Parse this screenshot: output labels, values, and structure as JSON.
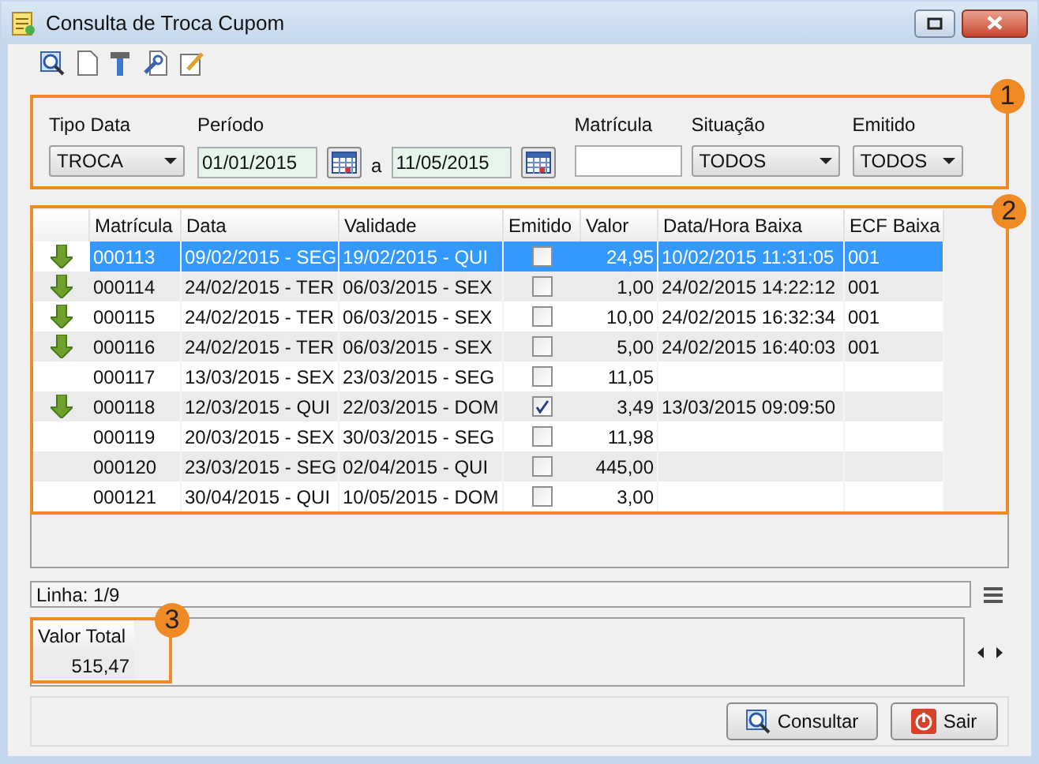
{
  "window": {
    "title": "Consulta de Troca Cupom"
  },
  "filters": {
    "tipo_data": {
      "label": "Tipo Data",
      "value": "TROCA"
    },
    "periodo": {
      "label": "Período",
      "from": "01/01/2015",
      "separator": "a",
      "to": "11/05/2015"
    },
    "matricula": {
      "label": "Matrícula"
    },
    "situacao": {
      "label": "Situação",
      "value": "TODOS"
    },
    "emitido": {
      "label": "Emitido",
      "value": "TODOS"
    }
  },
  "table": {
    "columns": [
      "Matrícula",
      "Data",
      "Validade",
      "Emitido",
      "Valor",
      "Data/Hora Baixa",
      "ECF Baixa"
    ],
    "rows": [
      {
        "arrow": true,
        "matricula": "000113",
        "data": "09/02/2015 - SEG",
        "validade": "19/02/2015 - QUI",
        "emitido": false,
        "valor": "24,95",
        "baixa": "10/02/2015 11:31:05",
        "ecf": "001",
        "selected": true
      },
      {
        "arrow": true,
        "matricula": "000114",
        "data": "24/02/2015 - TER",
        "validade": "06/03/2015 - SEX",
        "emitido": false,
        "valor": "1,00",
        "baixa": "24/02/2015 14:22:12",
        "ecf": "001",
        "selected": false
      },
      {
        "arrow": true,
        "matricula": "000115",
        "data": "24/02/2015 - TER",
        "validade": "06/03/2015 - SEX",
        "emitido": false,
        "valor": "10,00",
        "baixa": "24/02/2015 16:32:34",
        "ecf": "001",
        "selected": false
      },
      {
        "arrow": true,
        "matricula": "000116",
        "data": "24/02/2015 - TER",
        "validade": "06/03/2015 - SEX",
        "emitido": false,
        "valor": "5,00",
        "baixa": "24/02/2015 16:40:03",
        "ecf": "001",
        "selected": false
      },
      {
        "arrow": false,
        "matricula": "000117",
        "data": "13/03/2015 - SEX",
        "validade": "23/03/2015 - SEG",
        "emitido": false,
        "valor": "11,05",
        "selected": false
      },
      {
        "arrow": true,
        "matricula": "000118",
        "data": "12/03/2015 - QUI",
        "validade": "22/03/2015 - DOM",
        "emitido": true,
        "valor": "3,49",
        "baixa": "13/03/2015 09:09:50",
        "selected": false
      },
      {
        "arrow": false,
        "matricula": "000119",
        "data": "20/03/2015 - SEX",
        "validade": "30/03/2015 - SEG",
        "emitido": false,
        "valor": "11,98",
        "selected": false
      },
      {
        "arrow": false,
        "matricula": "000120",
        "data": "23/03/2015 - SEG",
        "validade": "02/04/2015 - QUI",
        "emitido": false,
        "valor": "445,00",
        "selected": false
      },
      {
        "arrow": false,
        "matricula": "000121",
        "data": "30/04/2015 - QUI",
        "validade": "10/05/2015 - DOM",
        "emitido": false,
        "valor": "3,00",
        "selected": false
      }
    ]
  },
  "status": {
    "linha": "Linha: 1/9"
  },
  "totals": {
    "label": "Valor Total",
    "value": "515,47"
  },
  "buttons": [
    {
      "kind": "search",
      "label": "Consultar"
    },
    {
      "kind": "exit",
      "label": "Sair"
    }
  ],
  "callouts": [
    "1",
    "2",
    "3"
  ]
}
